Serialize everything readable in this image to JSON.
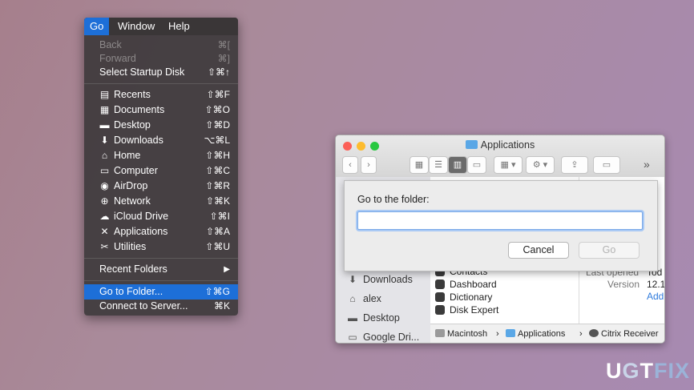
{
  "menubar": {
    "items": [
      "Go",
      "Window",
      "Help"
    ],
    "active": "Go"
  },
  "go_menu": {
    "top_items": [
      {
        "label": "Back",
        "shortcut": "⌘[",
        "disabled": true
      },
      {
        "label": "Forward",
        "shortcut": "⌘]",
        "disabled": true
      },
      {
        "label": "Select Startup Disk",
        "shortcut": "⇧⌘↑",
        "disabled": false
      }
    ],
    "places": [
      {
        "label": "Recents",
        "shortcut": "⇧⌘F",
        "icon": "recents-icon"
      },
      {
        "label": "Documents",
        "shortcut": "⇧⌘O",
        "icon": "documents-icon"
      },
      {
        "label": "Desktop",
        "shortcut": "⇧⌘D",
        "icon": "desktop-icon"
      },
      {
        "label": "Downloads",
        "shortcut": "⌥⌘L",
        "icon": "downloads-icon"
      },
      {
        "label": "Home",
        "shortcut": "⇧⌘H",
        "icon": "home-icon"
      },
      {
        "label": "Computer",
        "shortcut": "⇧⌘C",
        "icon": "computer-icon"
      },
      {
        "label": "AirDrop",
        "shortcut": "⇧⌘R",
        "icon": "airdrop-icon"
      },
      {
        "label": "Network",
        "shortcut": "⇧⌘K",
        "icon": "network-icon"
      },
      {
        "label": "iCloud Drive",
        "shortcut": "⇧⌘I",
        "icon": "icloud-icon"
      },
      {
        "label": "Applications",
        "shortcut": "⇧⌘A",
        "icon": "applications-icon"
      },
      {
        "label": "Utilities",
        "shortcut": "⇧⌘U",
        "icon": "utilities-icon"
      }
    ],
    "recent_folders": {
      "label": "Recent Folders",
      "arrow": "▶"
    },
    "go_to_folder": {
      "label": "Go to Folder...",
      "shortcut": "⇧⌘G"
    },
    "connect_to_server": {
      "label": "Connect to Server...",
      "shortcut": "⌘K"
    }
  },
  "finder": {
    "title": "Applications",
    "overflow_chevron": "»",
    "sidebar": [
      "Downloads",
      "alex",
      "Desktop",
      "Google Dri..."
    ],
    "column_items": [
      "Contacts",
      "Dashboard",
      "Dictionary",
      "Disk Expert"
    ],
    "info": {
      "last_opened_label": "Last opened",
      "last_opened_value": "Tod",
      "version_label": "Version",
      "version_value": "12.1",
      "add_link": "Add"
    },
    "path": [
      "Macintosh",
      "Applications",
      "Citrix Receiver"
    ]
  },
  "go_to_folder_sheet": {
    "label": "Go to the folder:",
    "input_value": "",
    "cancel_label": "Cancel",
    "go_label": "Go"
  },
  "watermark": {
    "part1": "U",
    "part2": "G",
    "part3": "T",
    "part4": "FIX"
  },
  "colors": {
    "menu_highlight": "#1d6fd8",
    "close": "#fc5f57",
    "minimize": "#fdbc2e",
    "zoom": "#28c840"
  }
}
